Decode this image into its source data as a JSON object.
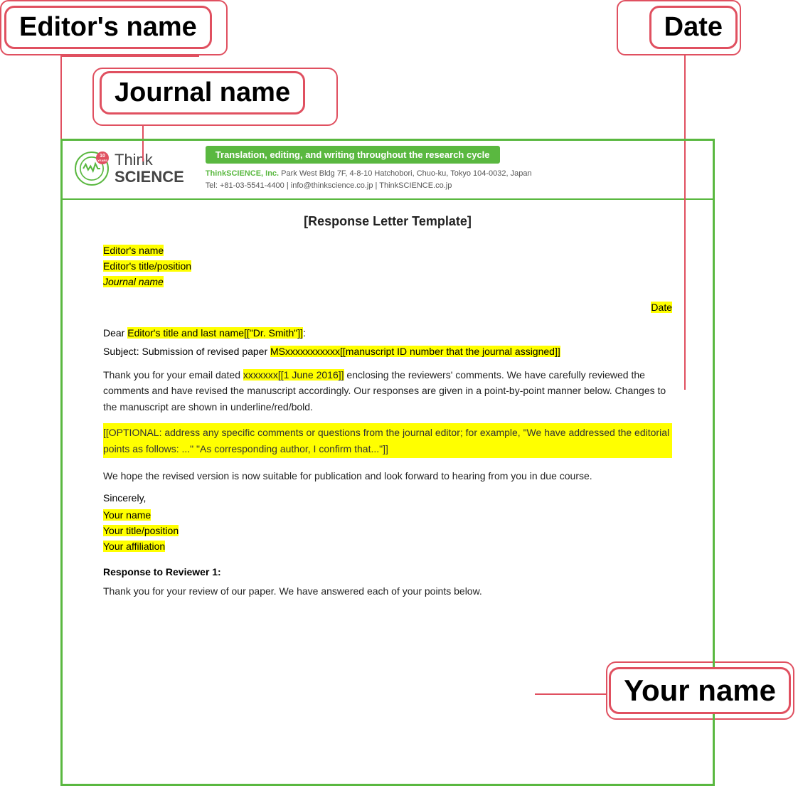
{
  "labels": {
    "editors_name": "Editor's name",
    "date": "Date",
    "journal_name": "Journal name",
    "your_name": "Your name"
  },
  "document": {
    "title": "[Response Letter Template]",
    "header": {
      "tagline": "Translation, editing, and writing throughout the research cycle",
      "company": "ThinkSCIENCE, Inc.",
      "address": "Park West Bldg 7F, 4-8-10 Hatchobori, Chuo-ku, Tokyo 104-0032, Japan",
      "tel": "Tel: +81-03-5541-4400 | info@thinkscience.co.jp | ThinkSCIENCE.co.jp",
      "logo_think": "Think",
      "logo_science": "SCIENCE",
      "badge_top": "10",
      "badge_bottom": "YEARS"
    },
    "fields": {
      "editors_name": "Editor's name",
      "editors_title": "Editor's title/position",
      "journal_name": "Journal name",
      "date": "Date",
      "dear": "Dear Editor's title and last name[[\"Dr. Smith\"]]:",
      "subject_prefix": "Subject:  Submission of revised paper",
      "manuscript_id": "MSxxxxxxxxxxx[[manuscript ID number that the journal assigned]]",
      "thank_you": "Thank you for your email dated",
      "date_ref": "xxxxxxx[[1 June 2016]]",
      "body1_cont": "enclosing the reviewers' comments. We have carefully reviewed the comments and have revised the manuscript accordingly. Our responses are given in a point-by-point manner below. Changes to the manuscript are shown in underline/red/bold.",
      "optional": "[[OPTIONAL: address any specific comments or questions from the journal editor; for example, \"We have addressed the editorial points as follows: ...\" \"As corresponding author, I confirm that...\"]]",
      "hope": "We hope the revised version is now suitable for publication and look forward to hearing from you in due course.",
      "sincerely": "Sincerely,",
      "your_name": "Your name",
      "your_title": "Your title/position",
      "your_affiliation": "Your affiliation",
      "reviewer_heading": "Response to Reviewer 1:",
      "reviewer_para": "Thank you for your review of our paper. We have answered each of your points below."
    }
  }
}
